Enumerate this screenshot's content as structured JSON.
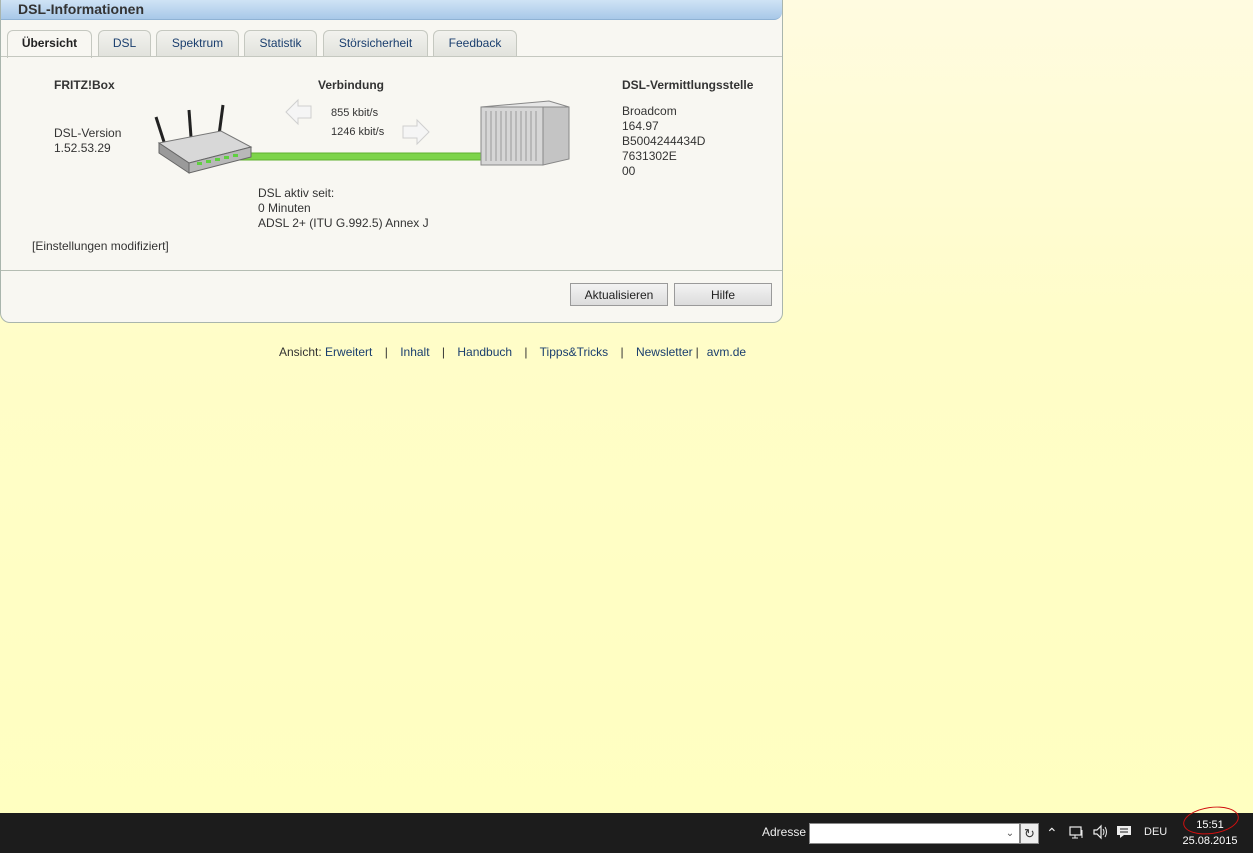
{
  "panel": {
    "title": "DSL-Informationen",
    "tabs": [
      {
        "label": "Übersicht",
        "active": true
      },
      {
        "label": "DSL"
      },
      {
        "label": "Spektrum"
      },
      {
        "label": "Statistik"
      },
      {
        "label": "Störsicherheit"
      },
      {
        "label": "Feedback"
      }
    ]
  },
  "fritzbox": {
    "heading": "FRITZ!Box",
    "version_label": "DSL-Version",
    "version_value": "1.52.53.29"
  },
  "connection": {
    "heading": "Verbindung",
    "upstream": "855 kbit/s",
    "downstream": "1246 kbit/s",
    "active_since_label": "DSL aktiv seit:",
    "active_since_value": "0 Minuten",
    "mode": "ADSL 2+ (ITU G.992.5) Annex J"
  },
  "exchange": {
    "heading": "DSL-Vermittlungsstelle",
    "lines": [
      "Broadcom",
      "164.97",
      "B5004244434D",
      "7631302E",
      "00"
    ]
  },
  "settings_note": "[Einstellungen modifiziert]",
  "buttons": {
    "refresh": "Aktualisieren",
    "help": "Hilfe"
  },
  "footer": {
    "view_label": "Ansicht:",
    "view_value": "Erweitert",
    "links": [
      "Inhalt",
      "Handbuch",
      "Tipps&Tricks",
      "Newsletter"
    ],
    "last_link": "avm.de"
  },
  "taskbar": {
    "address_label": "Adresse",
    "address_value": "",
    "language": "DEU",
    "time": "15:51",
    "date": "25.08.2015"
  },
  "colors": {
    "link": "#1a3e6e",
    "line_green": "#7dd44a",
    "annotation_red": "#d01010"
  }
}
